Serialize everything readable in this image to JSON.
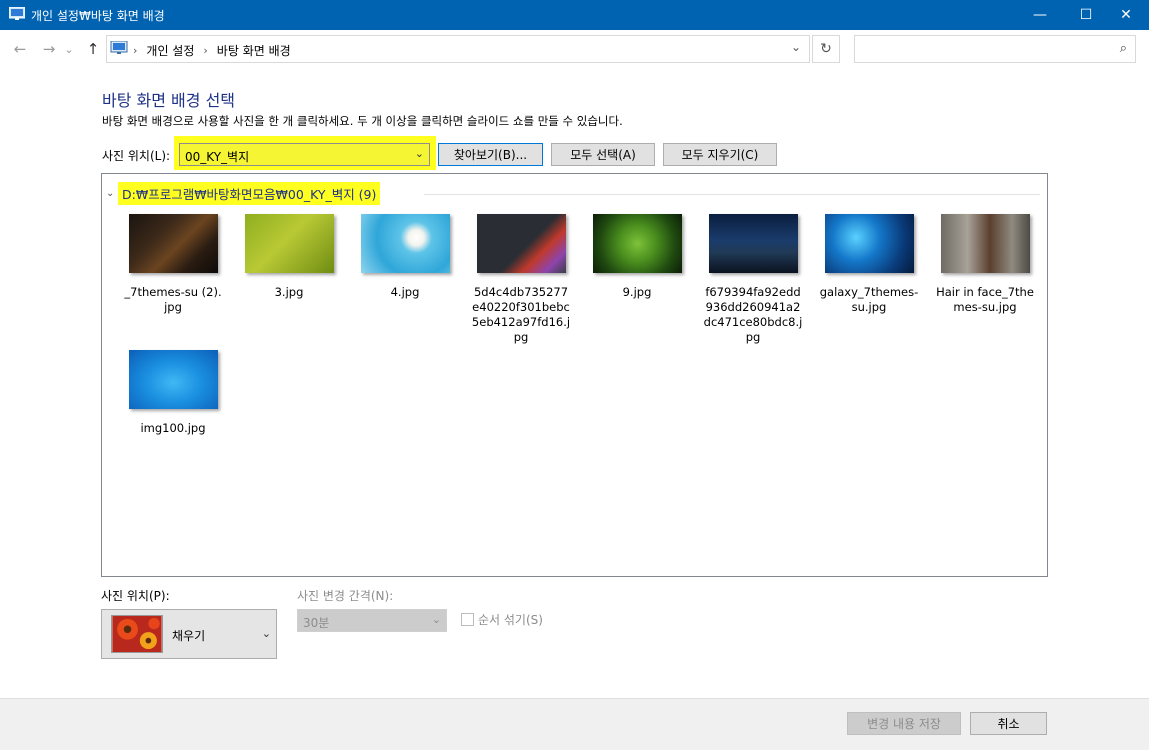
{
  "window": {
    "title": "개인 설정₩바탕 화면 배경",
    "minimize": "—",
    "maximize": "☐",
    "close": "✕"
  },
  "nav": {
    "back_icon": "←",
    "forward_icon": "→",
    "history_icon": "⌄",
    "up_icon": "↑"
  },
  "address": {
    "crumbs": [
      "개인 설정",
      "바탕 화면 배경"
    ],
    "sep": "›",
    "dropdown_icon": "⌄",
    "refresh_icon": "↻"
  },
  "search": {
    "placeholder": "",
    "icon": "⌕"
  },
  "main": {
    "heading": "바탕 화면 배경 선택",
    "description": "바탕 화면 배경으로 사용할 사진을 한 개 클릭하세요. 두 개 이상을 클릭하면 슬라이드 쇼를 만들 수 있습니다."
  },
  "location": {
    "label": "사진 위치(L):",
    "value": "00_KY_벽지",
    "chevron": "⌄",
    "browse": "찾아보기(B)...",
    "select_all": "모두 선택(A)",
    "clear_all": "모두 지우기(C)"
  },
  "group": {
    "chevron": "⌄",
    "title": "D:₩프로그램₩바탕화면모음₩00_KY_벽지 (9)"
  },
  "pictures": [
    {
      "name": "_7themes-su (2).jpg",
      "bg": "linear-gradient(135deg,#1a1410 0%,#3d2a1a 35%,#6b4420 55%,#2a1c12 75%,#0e0a08 100%)"
    },
    {
      "name": "3.jpg",
      "bg": "linear-gradient(135deg,#8fae1f 0%,#b9c935 45%,#6f8c12 100%)"
    },
    {
      "name": "4.jpg",
      "bg": "radial-gradient(circle at 62% 40%,#ffffff 0%,#f3f3ee 12%,#5ec4e8 24%,#2fa6d9 60%,#8fd5ee 100%)"
    },
    {
      "name": "5d4c4db735277e40220f301bebc5eb412a97fd16.jpg",
      "bg": "linear-gradient(135deg,#2a2d33 0%,#2a2d33 55%,#c0392b 70%,#8e44ad 85%,#3a3f47 100%)"
    },
    {
      "name": "9.jpg",
      "bg": "radial-gradient(circle at 50% 50%,#7ec23a 0%,#4a8e1e 35%,#1f4a10 70%,#0c1e07 100%)"
    },
    {
      "name": "f679394fa92edd936dd260941a2dc471ce80bdc8.jpg",
      "bg": "linear-gradient(180deg,#0b1e3f 0%,#1a3c6c 45%,#203a56 65%,#0b1220 100%)"
    },
    {
      "name": "galaxy_7themes-su.jpg",
      "bg": "radial-gradient(circle at 35% 40%,#5ad1ff 0%,#1477c9 35%,#0a3b7a 70%,#041a3a 100%)"
    },
    {
      "name": "Hair in face_7themes-su.jpg",
      "bg": "linear-gradient(90deg,#6e6a64 0%,#a8a298 30%,#5a3f2e 55%,#8f8a80 80%,#4d4a45 100%)"
    },
    {
      "name": "img100.jpg",
      "bg": "radial-gradient(ellipse at 50% 55%,#3fb8f4 0%,#1a8fe0 45%,#0b5fb8 100%)"
    }
  ],
  "options": {
    "position_label": "사진 위치(P):",
    "position_value": "채우기",
    "position_chevron": "⌄",
    "interval_label": "사진 변경 간격(N):",
    "interval_value": "30분",
    "interval_chevron": "⌄",
    "shuffle_label": "순서 섞기(S)"
  },
  "footer": {
    "save": "변경 내용 저장",
    "cancel": "취소"
  }
}
